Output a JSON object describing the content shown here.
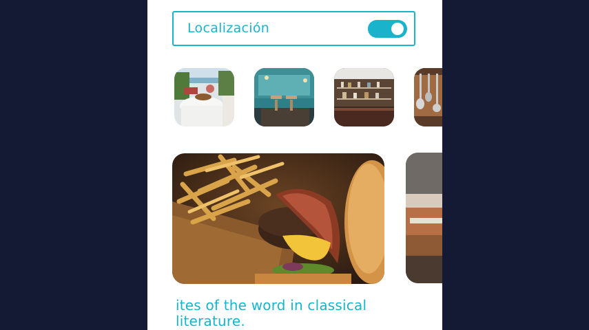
{
  "location": {
    "label": "Localización",
    "enabled": true
  },
  "colors": {
    "accent": "#19b4cc",
    "backdrop": "#141a33",
    "surface": "#ffffff"
  },
  "thumbnails": [
    {
      "name": "terrace-restaurant-photo"
    },
    {
      "name": "blue-cafe-interior-photo"
    },
    {
      "name": "bar-shelves-photo"
    },
    {
      "name": "hanging-utensils-photo"
    }
  ],
  "cards": [
    {
      "name": "burger-and-fries-photo"
    },
    {
      "name": "dish-photo-partial"
    }
  ],
  "caption": {
    "text": "ites of the word in classical literature."
  }
}
